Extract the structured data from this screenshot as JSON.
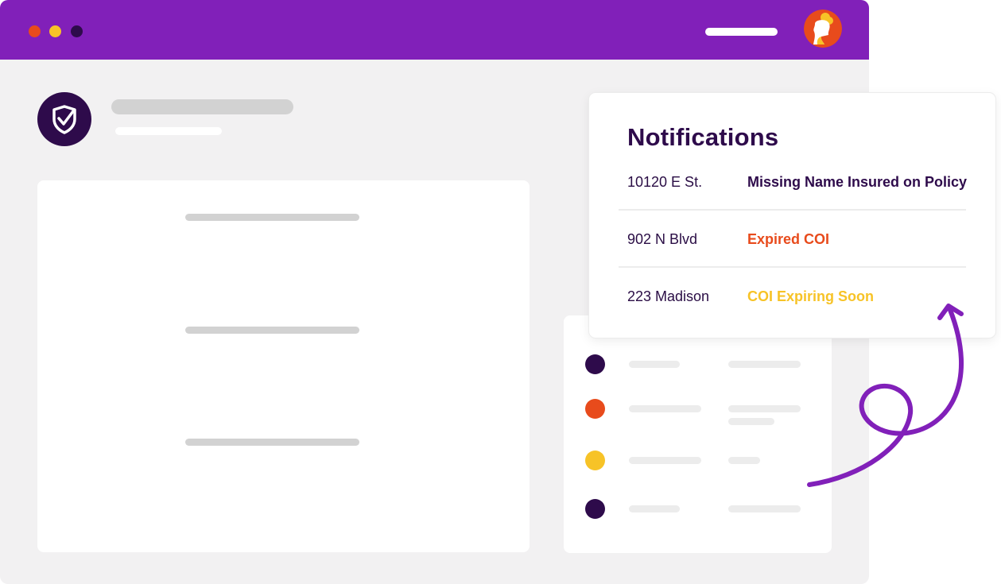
{
  "colors": {
    "brand_purple": "#8120b9",
    "dark_purple": "#2e0b4b",
    "orange": "#e84b1c",
    "yellow": "#f7c327",
    "panel_bg": "#f2f1f2"
  },
  "window": {
    "traffic_lights": [
      "red-dot",
      "yellow-dot",
      "dark-dot"
    ],
    "avatar_icon": "user-avatar-icon"
  },
  "header": {
    "badge_icon": "shield-check-icon"
  },
  "notifications": {
    "title": "Notifications",
    "items": [
      {
        "address": "10120 E St.",
        "message": "Missing Name Insured on Policy",
        "color": "#2e0b4b"
      },
      {
        "address": "902 N Blvd",
        "message": "Expired COI",
        "color": "#e84b1c"
      },
      {
        "address": "223 Madison",
        "message": "COI Expiring Soon",
        "color": "#f7c327"
      }
    ]
  },
  "status_list": {
    "dots": [
      "#2e0b4b",
      "#e84b1c",
      "#f7c327",
      "#2e0b4b"
    ]
  },
  "decoration": {
    "arrow_icon": "curly-arrow-icon"
  }
}
